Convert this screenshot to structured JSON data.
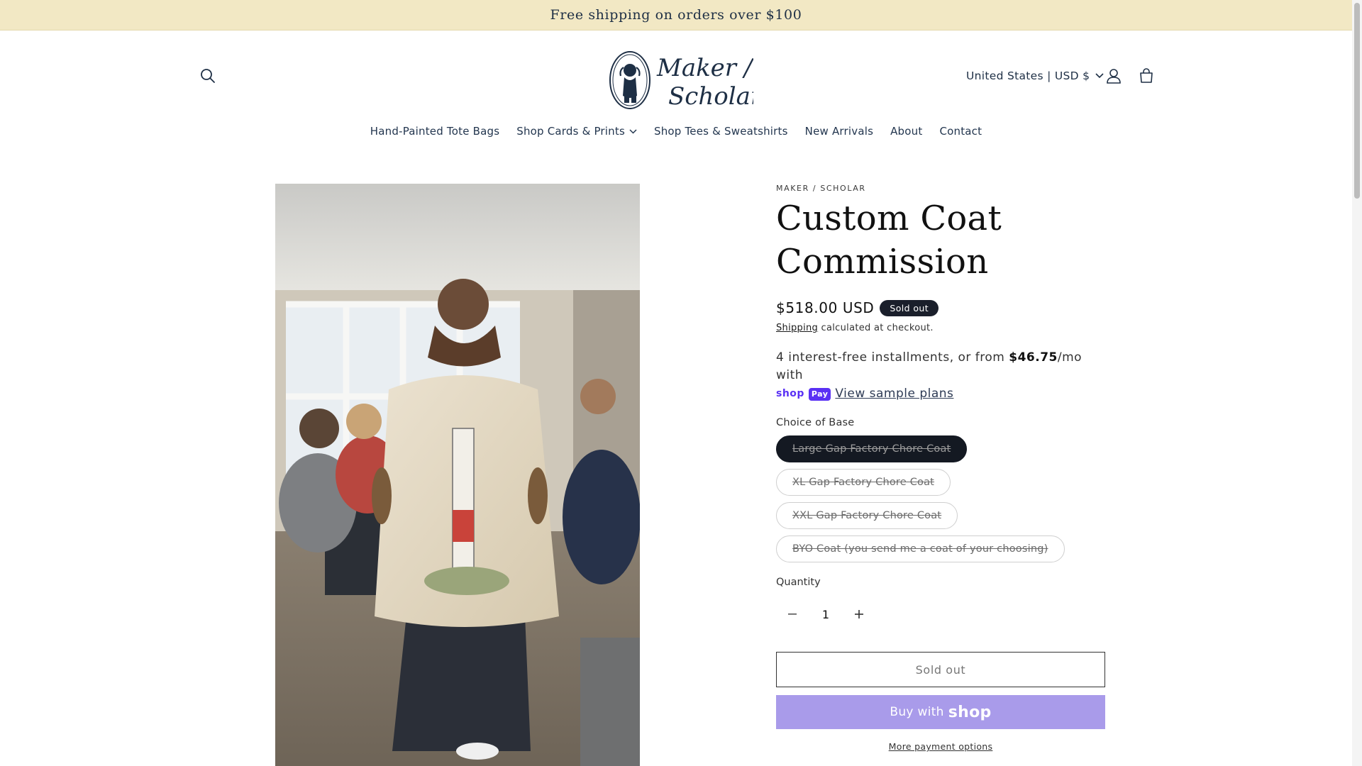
{
  "announcement": {
    "text": "Free shipping on orders over $100"
  },
  "header": {
    "logo_text": "Maker / Scholar",
    "country_selector": "United States | USD $"
  },
  "nav": {
    "items": [
      {
        "label": "Hand-Painted Tote Bags",
        "has_dropdown": false
      },
      {
        "label": "Shop Cards & Prints",
        "has_dropdown": true
      },
      {
        "label": "Shop Tees & Sweatshirts",
        "has_dropdown": false
      },
      {
        "label": "New Arrivals",
        "has_dropdown": false
      },
      {
        "label": "About",
        "has_dropdown": false
      },
      {
        "label": "Contact",
        "has_dropdown": false
      }
    ]
  },
  "product": {
    "vendor": "MAKER / SCHOLAR",
    "title": "Custom Coat Commission",
    "price": "$518.00 USD",
    "badge": "Sold out",
    "shipping_link": "Shipping",
    "shipping_text": " calculated at checkout.",
    "installments_prefix": "4 interest-free installments, or from ",
    "installments_amount": "$46.75",
    "installments_suffix": "/mo with",
    "shoppay_badge": "Pay",
    "shoppay_word": "shop",
    "sample_plans": "View sample plans",
    "choice_label": "Choice of Base",
    "variants": [
      {
        "label": "Large Gap Factory Chore Coat",
        "selected": true
      },
      {
        "label": "XL Gap Factory Chore Coat",
        "selected": false
      },
      {
        "label": "XXL Gap Factory Chore Coat",
        "selected": false
      },
      {
        "label": "BYO Coat (you send me a coat of your choosing)",
        "selected": false
      }
    ],
    "quantity_label": "Quantity",
    "quantity": "1",
    "sold_out_button": "Sold out",
    "buy_with": "Buy with",
    "shop_word": "shop",
    "more_payment": "More payment options"
  },
  "colors": {
    "announcement_bg": "#f2e8c4",
    "navy": "#1e2f45",
    "shop_purple": "#a99bea",
    "badge_bg": "#1a1f2b"
  }
}
